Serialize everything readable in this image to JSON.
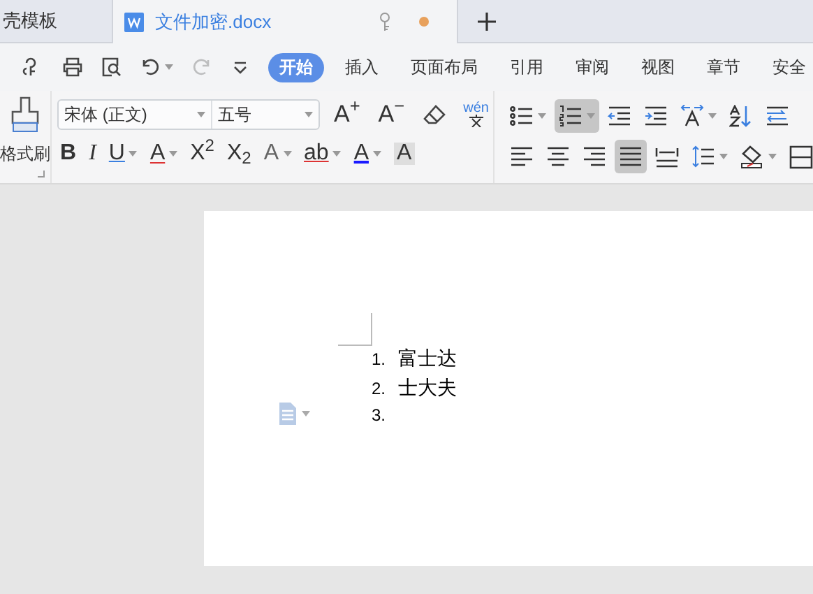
{
  "tabs": [
    {
      "label": "壳模板",
      "selected": false
    },
    {
      "label": "文件加密.docx",
      "selected": true,
      "unsaved": true
    }
  ],
  "quick_access": [
    {
      "kind": "save-cloud"
    },
    {
      "kind": "print"
    },
    {
      "kind": "preview"
    },
    {
      "kind": "undo"
    },
    {
      "kind": "redo",
      "disabled": true
    },
    {
      "kind": "more"
    }
  ],
  "menu": [
    {
      "label": "开始",
      "selected": true
    },
    {
      "label": "插入",
      "selected": false
    },
    {
      "label": "页面布局",
      "selected": false
    },
    {
      "label": "引用",
      "selected": false
    },
    {
      "label": "审阅",
      "selected": false
    },
    {
      "label": "视图",
      "selected": false
    },
    {
      "label": "章节",
      "selected": false
    },
    {
      "label": "安全",
      "selected": false
    }
  ],
  "format_painter": {
    "label": "格式刷"
  },
  "font": {
    "name": "宋体 (正文)",
    "size": "五号"
  },
  "font_tools": [
    {
      "kind": "text",
      "label": "A$^{+}$"
    },
    {
      "kind": "text",
      "label": "A$^{−}$"
    },
    {
      "kind": "eraser"
    },
    {
      "kind": "phonetic",
      "label": "wén"
    }
  ],
  "format_buttons": [
    {
      "label": "B",
      "kind": "bold",
      "dropdown": false
    },
    {
      "label": "I",
      "kind": "italic",
      "dropdown": false
    },
    {
      "label": "U",
      "kind": "underline",
      "dropdown": true
    },
    {
      "label": "A",
      "kind": "strike",
      "dropdown": true
    },
    {
      "label": "X$^{2}$",
      "kind": "plain",
      "dropdown": false
    },
    {
      "label": "X$_{2}$",
      "kind": "plain",
      "dropdown": false
    },
    {
      "label": "A",
      "kind": "outline",
      "dropdown": true
    },
    {
      "label": "ab",
      "kind": "highlight",
      "dropdown": true
    },
    {
      "label": "A",
      "kind": "color",
      "dropdown": true
    },
    {
      "label": "A",
      "kind": "shade",
      "dropdown": false
    }
  ],
  "paragraph_row_1": [
    {
      "kind": "bullets",
      "dropdown": true,
      "selected": false
    },
    {
      "kind": "numbering",
      "dropdown": true,
      "selected": true
    },
    {
      "kind": "outdent",
      "dropdown": false,
      "selected": false
    },
    {
      "kind": "indent",
      "dropdown": false,
      "selected": false
    },
    {
      "kind": "direction",
      "dropdown": true,
      "selected": false
    },
    {
      "kind": "sort",
      "dropdown": false,
      "selected": false
    },
    {
      "kind": "tabs",
      "dropdown": false,
      "selected": false
    }
  ],
  "paragraph_row_2": [
    {
      "kind": "left",
      "dropdown": false,
      "selected": false
    },
    {
      "kind": "center",
      "dropdown": false,
      "selected": false
    },
    {
      "kind": "right",
      "dropdown": false,
      "selected": false
    },
    {
      "kind": "justify",
      "dropdown": false,
      "selected": true
    },
    {
      "kind": "distribute",
      "dropdown": false,
      "selected": false
    },
    {
      "kind": "spacing",
      "dropdown": true,
      "selected": false
    },
    {
      "kind": "fill",
      "dropdown": true,
      "selected": false
    },
    {
      "kind": "border",
      "dropdown": false,
      "selected": false
    }
  ],
  "document": {
    "list": [
      {
        "number": "1.",
        "text": "富士达"
      },
      {
        "number": "2.",
        "text": "士大夫"
      },
      {
        "number": "3."
      }
    ]
  }
}
